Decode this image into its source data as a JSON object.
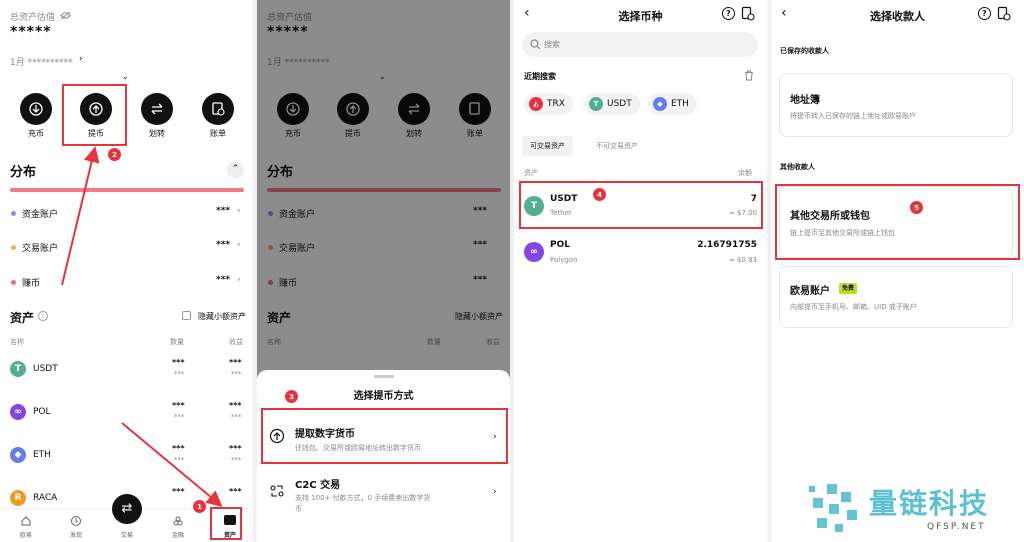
{
  "panel1": {
    "total_label": "总资产估值",
    "total_value": "*****",
    "sub_value": "1月 **********",
    "actions": [
      {
        "label": "充币",
        "icon": "deposit-icon"
      },
      {
        "label": "提币",
        "icon": "withdraw-icon"
      },
      {
        "label": "划转",
        "icon": "transfer-icon"
      },
      {
        "label": "账单",
        "icon": "bill-icon"
      }
    ],
    "section_distribution": "分布",
    "accounts": [
      {
        "name": "资金账户",
        "value": "***",
        "color": "#8a8ef0"
      },
      {
        "name": "交易账户",
        "value": "***",
        "color": "#e8b84a"
      },
      {
        "name": "赚币",
        "value": "***",
        "color": "#f06c7c"
      }
    ],
    "section_assets": "资产",
    "hide_small_label": "隐藏小额资产",
    "col_name": "名称",
    "col_amount": "数量",
    "col_profit": "收益",
    "assets": [
      {
        "symbol": "USDT",
        "v1": "***",
        "v2": "***",
        "color": "#53ae94",
        "glyph": "T"
      },
      {
        "symbol": "POL",
        "v1": "***",
        "v2": "***",
        "color": "#8247e5",
        "glyph": "∞"
      },
      {
        "symbol": "ETH",
        "v1": "***",
        "v2": "***",
        "color": "#627eea",
        "glyph": "◆"
      },
      {
        "symbol": "RACA",
        "v1": "***",
        "v2": "***",
        "color": "#f29a1f",
        "glyph": "R"
      }
    ],
    "nav": [
      "欧易",
      "发现",
      "交易",
      "金融",
      "资产"
    ]
  },
  "panel2": {
    "sheet_title": "选择提币方式",
    "option1_title": "提取数字货币",
    "option1_desc": "往钱包、交易所或欧易地址转出数字货币",
    "option2_title": "C2C 交易",
    "option2_desc_line1": "支持 100+ 付款方式，0 手续费卖出数字货",
    "option2_desc_line2": "币"
  },
  "panel3": {
    "title": "选择币种",
    "search_placeholder": "搜索",
    "recent_label": "近期搜索",
    "recent": [
      {
        "symbol": "TRX",
        "color": "#e5343c",
        "glyph": "◭"
      },
      {
        "symbol": "USDT",
        "color": "#53ae94",
        "glyph": "T"
      },
      {
        "symbol": "ETH",
        "color": "#627eea",
        "glyph": "◆"
      }
    ],
    "tab_tradable": "可交易资产",
    "tab_untradable": "不可交易资产",
    "col_asset": "资产",
    "col_balance": "余额",
    "coins": [
      {
        "symbol": "USDT",
        "name": "Tether",
        "amount": "7",
        "usd": "≈ $7.00",
        "color": "#53ae94",
        "glyph": "T"
      },
      {
        "symbol": "POL",
        "name": "Polygon",
        "amount": "2.16791755",
        "usd": "≈ $0.93",
        "color": "#8247e5",
        "glyph": "∞"
      }
    ]
  },
  "panel4": {
    "title": "选择收款人",
    "saved_label": "已保存的收款人",
    "address_book_title": "地址簿",
    "address_book_desc": "将提币转入已保存的链上地址或欧易账户",
    "other_label": "其他收款人",
    "exchange_title": "其他交易所或钱包",
    "exchange_desc": "链上提币至其他交易所或链上钱包",
    "okx_title": "欧易账户",
    "okx_badge": "免费",
    "okx_desc": "内部提币至手机号、邮箱、UID 或子账户"
  },
  "steps": [
    "1",
    "2",
    "3",
    "4",
    "5"
  ],
  "watermark": {
    "text": "量链科技",
    "sub": "QFSP.NET"
  },
  "colors": {
    "highlight": "#e5343c",
    "accent_green": "#b7e02a"
  }
}
